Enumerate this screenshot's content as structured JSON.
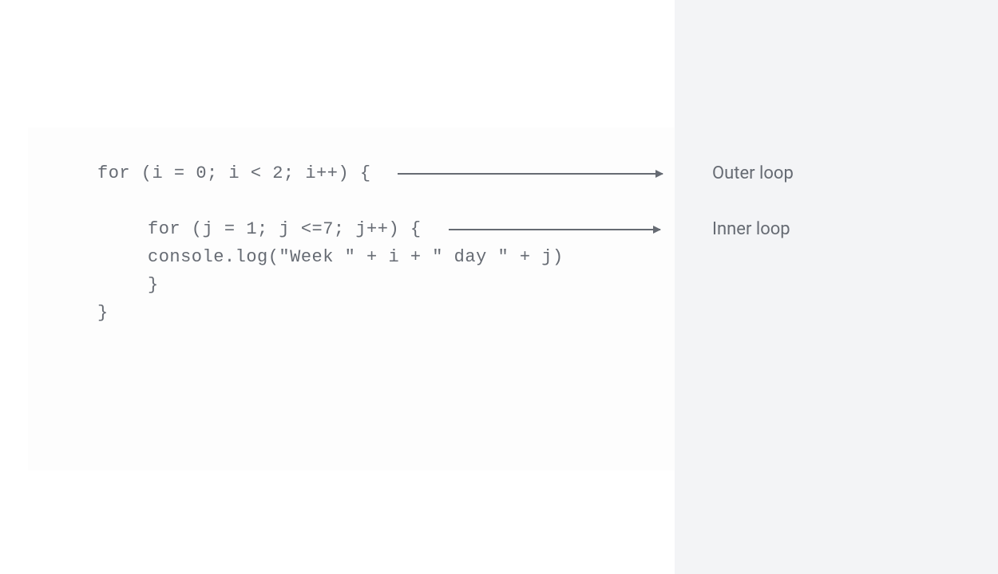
{
  "code": {
    "line1": "for (i = 0; i < 2; i++) {",
    "line2": "for (j = 1; j <=7; j++) {",
    "line3": "console.log(\"Week \" + i + \" day \" + j)",
    "line4": "}",
    "line5": "}"
  },
  "labels": {
    "outer": "Outer loop",
    "inner": "Inner loop"
  }
}
